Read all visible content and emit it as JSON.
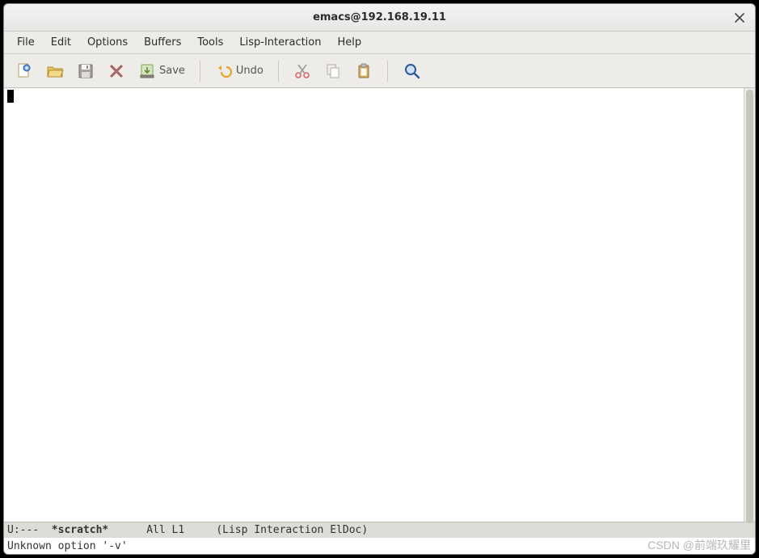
{
  "window": {
    "title": "emacs@192.168.19.11"
  },
  "menubar": {
    "items": [
      "File",
      "Edit",
      "Options",
      "Buffers",
      "Tools",
      "Lisp-Interaction",
      "Help"
    ]
  },
  "toolbar": {
    "save_label": "Save",
    "undo_label": "Undo"
  },
  "modeline": {
    "state": "U:--- ",
    "buffer": " *scratch*",
    "gap1": "      ",
    "position": "All L1",
    "gap2": "     ",
    "mode": "(Lisp Interaction ElDoc)"
  },
  "echo": {
    "message": "Unknown option '-v'"
  },
  "watermark": "CSDN @前端玖耀里"
}
